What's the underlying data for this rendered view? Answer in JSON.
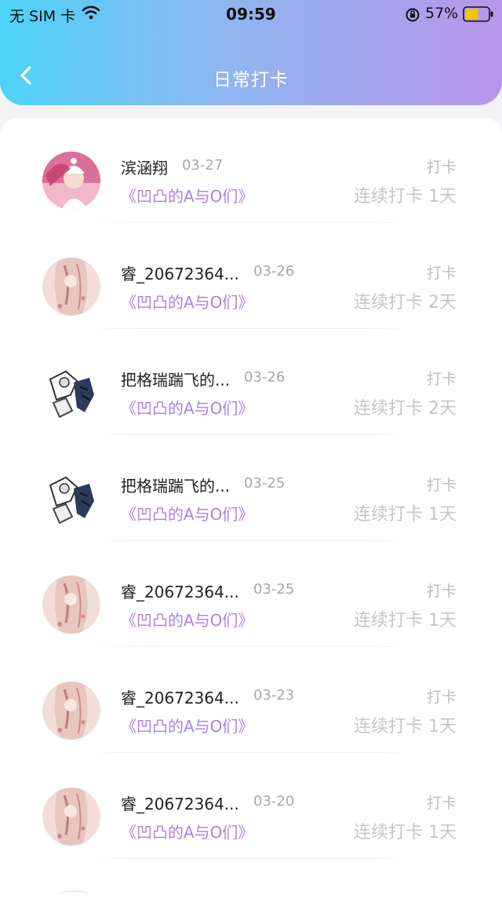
{
  "status_bar": {
    "carrier": "无 SIM 卡",
    "time": "09:59",
    "battery_percent": "57%",
    "battery_level": 0.57,
    "battery_color": "#f5c400"
  },
  "nav": {
    "title": "日常打卡",
    "back_icon": "chevron-left-icon"
  },
  "checkins": [
    {
      "user": "滨涵翔",
      "date": "03-27",
      "book": "《凹凸的A与O们》",
      "action": "打卡",
      "streak": "连续打卡 1天"
    },
    {
      "user": "睿_20672364...",
      "date": "03-26",
      "book": "《凹凸的A与O们》",
      "action": "打卡",
      "streak": "连续打卡 2天"
    },
    {
      "user": "把格瑞踹飞的...",
      "date": "03-26",
      "book": "《凹凸的A与O们》",
      "action": "打卡",
      "streak": "连续打卡 2天"
    },
    {
      "user": "把格瑞踹飞的...",
      "date": "03-25",
      "book": "《凹凸的A与O们》",
      "action": "打卡",
      "streak": "连续打卡 1天"
    },
    {
      "user": "睿_20672364...",
      "date": "03-25",
      "book": "《凹凸的A与O们》",
      "action": "打卡",
      "streak": "连续打卡 1天"
    },
    {
      "user": "睿_20672364...",
      "date": "03-23",
      "book": "《凹凸的A与O们》",
      "action": "打卡",
      "streak": "连续打卡 1天"
    },
    {
      "user": "睿_20672364...",
      "date": "03-20",
      "book": "《凹凸的A与O们》",
      "action": "打卡",
      "streak": "连续打卡 1天"
    }
  ],
  "colors": {
    "header_gradient_start": "#4cd3f7",
    "header_gradient_end": "#b896ea",
    "book_title": "#b07fe0",
    "muted_text": "#bdbdbd"
  }
}
